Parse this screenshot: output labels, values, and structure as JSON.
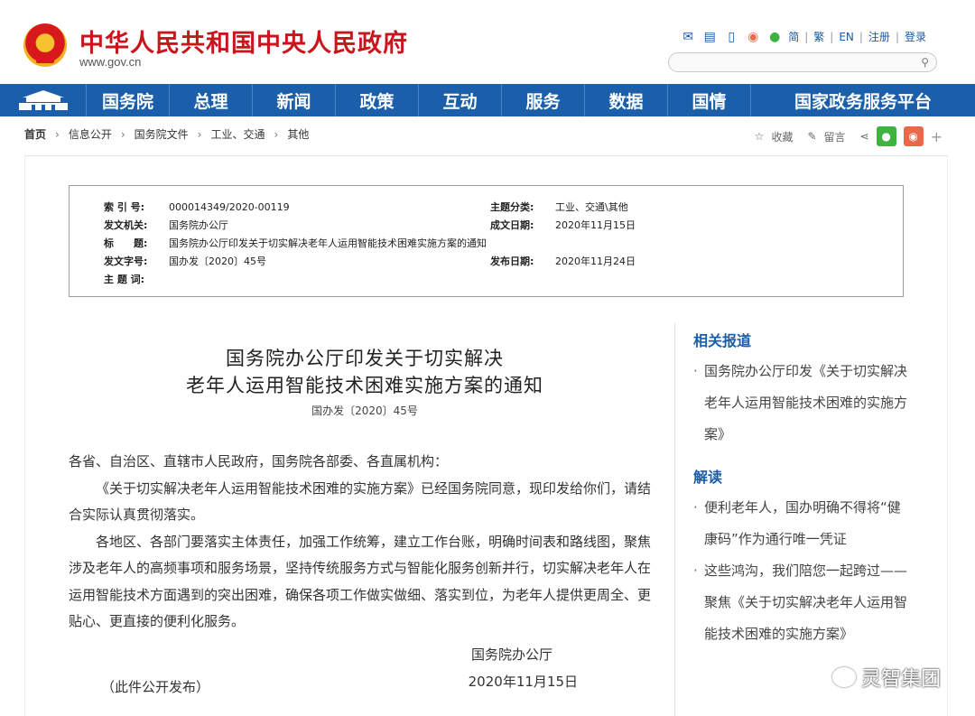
{
  "header": {
    "site_title": "中华人民共和国中央人民政府",
    "site_url": "www.gov.cn",
    "links": [
      "简",
      "繁",
      "EN",
      "注册",
      "登录"
    ],
    "icons": [
      "mail-icon",
      "message-icon",
      "mobile-icon",
      "weibo-icon",
      "wechat-icon"
    ],
    "search_placeholder": ""
  },
  "nav": {
    "items": [
      "国务院",
      "总理",
      "新闻",
      "政策",
      "互动",
      "服务",
      "数据",
      "国情",
      "国家政务服务平台"
    ]
  },
  "breadcrumb": {
    "items": [
      "首页",
      "信息公开",
      "国务院文件",
      "工业、交通",
      "其他"
    ]
  },
  "tools": {
    "favorite": "收藏",
    "comment": "留言"
  },
  "meta": {
    "index_no_label": "索 引 号:",
    "index_no": "000014349/2020-00119",
    "category_label": "主题分类:",
    "category": "工业、交通\\其他",
    "issuer_label": "发文机关:",
    "issuer": "国务院办公厅",
    "written_label": "成文日期:",
    "written": "2020年11月15日",
    "title_label": "标　　题:",
    "title": "国务院办公厅印发关于切实解决老年人运用智能技术困难实施方案的通知",
    "doc_no_label": "发文字号:",
    "doc_no": "国办发〔2020〕45号",
    "published_label": "发布日期:",
    "published": "2020年11月24日",
    "keywords_label": "主 题 词:"
  },
  "article": {
    "title_line1": "国务院办公厅印发关于切实解决",
    "title_line2": "老年人运用智能技术困难实施方案的通知",
    "doc_no": "国办发〔2020〕45号",
    "recipients": "各省、自治区、直辖市人民政府，国务院各部委、各直属机构：",
    "para1": "《关于切实解决老年人运用智能技术困难的实施方案》已经国务院同意，现印发给你们，请结合实际认真贯彻落实。",
    "para2": "各地区、各部门要落实主体责任，加强工作统筹，建立工作台账，明确时间表和路线图，聚焦涉及老年人的高频事项和服务场景，坚持传统服务方式与智能化服务创新并行，切实解决老年人在运用智能技术方面遇到的突出困难，确保各项工作做实做细、落实到位，为老年人提供更周全、更贴心、更直接的便利化服务。",
    "sign_org": "国务院办公厅",
    "sign_date": "2020年11月15日",
    "public_note": "（此件公开发布）"
  },
  "sidebar": {
    "related_title": "相关报道",
    "related_item": "国务院办公厅印发《关于切实解决老年人运用智能技术困难的实施方案》",
    "interpret_title": "解读",
    "interpret_item1": "便利老年人，国办明确不得将“健康码”作为通行唯一凭证",
    "interpret_item2": "这些鸿沟，我们陪您一起跨过——聚焦《关于切实解决老年人运用智能技术困难的实施方案》"
  },
  "watermark": "灵智集团",
  "colors": {
    "brand_red": "#c8161d",
    "nav_blue": "#1b5eaa",
    "wechat_green": "#3fb33f",
    "weibo_orange": "#e9694a"
  }
}
